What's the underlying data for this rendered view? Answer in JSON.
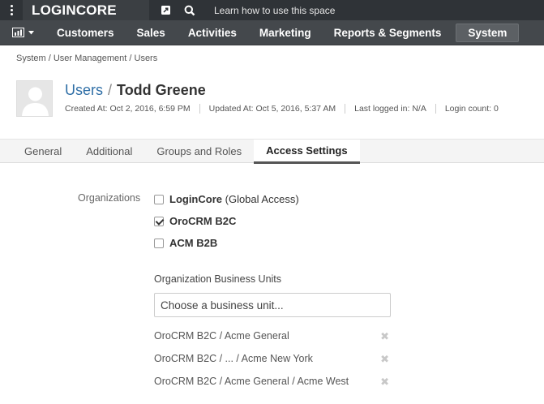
{
  "topbar": {
    "logo": "LOGINCORE",
    "help_text": "Learn how to use this space",
    "icons": [
      "menu-dots-icon",
      "share-icon",
      "search-icon"
    ]
  },
  "nav": {
    "items": [
      {
        "label": "Customers"
      },
      {
        "label": "Sales"
      },
      {
        "label": "Activities"
      },
      {
        "label": "Marketing"
      },
      {
        "label": "Reports & Segments"
      },
      {
        "label": "System",
        "active": true
      }
    ]
  },
  "breadcrumb": "System / User Management / Users",
  "user": {
    "section_link": "Users",
    "separator": "/",
    "name": "Todd Greene",
    "meta": {
      "created": "Created At: Oct 2, 2016, 6:59 PM",
      "updated": "Updated At: Oct 5, 2016, 5:37 AM",
      "last_logged": "Last logged in: N/A",
      "login_count": "Login count: 0"
    }
  },
  "tabs": [
    {
      "label": "General"
    },
    {
      "label": "Additional"
    },
    {
      "label": "Groups and Roles"
    },
    {
      "label": "Access Settings",
      "active": true
    }
  ],
  "form": {
    "organizations_label": "Organizations",
    "organizations": [
      {
        "name": "LoginCore",
        "suffix": "(Global Access)",
        "checked": false
      },
      {
        "name": "OroCRM B2C",
        "suffix": "",
        "checked": true
      },
      {
        "name": "ACM B2B",
        "suffix": "",
        "checked": false
      }
    ],
    "business_units_label": "Organization Business Units",
    "business_unit_placeholder": "Choose a business unit...",
    "business_units": [
      "OroCRM B2C / Acme General",
      "OroCRM B2C / ... / Acme New York",
      "OroCRM B2C / Acme General / Acme West"
    ]
  }
}
